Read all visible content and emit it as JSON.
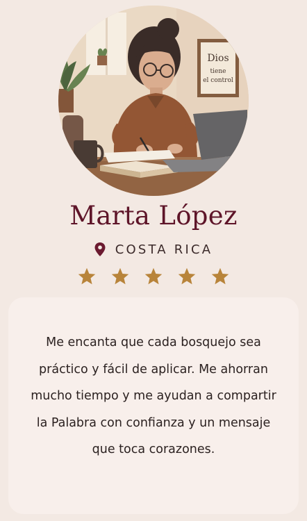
{
  "testimonial": {
    "name": "Marta López",
    "location": "COSTA RICA",
    "rating": 5,
    "rating_max": 5,
    "quote_lines": [
      "Me encanta que cada bosquejo sea",
      "práctico y fácil de aplicar. Me ahorran",
      "mucho tiempo y me ayudan a compartir",
      "la Palabra con confianza y un mensaje",
      "que toca corazones."
    ]
  },
  "photo": {
    "sign_lines": [
      "Dios",
      "tiene",
      "el control"
    ]
  },
  "icons": {
    "location": "map-pin-icon",
    "rating": "star-icon"
  },
  "colors": {
    "name": "#5e1529",
    "pin": "#6b1a30",
    "star": "#b8843a",
    "background": "#f3e9e3",
    "card": "#f8efeb"
  }
}
